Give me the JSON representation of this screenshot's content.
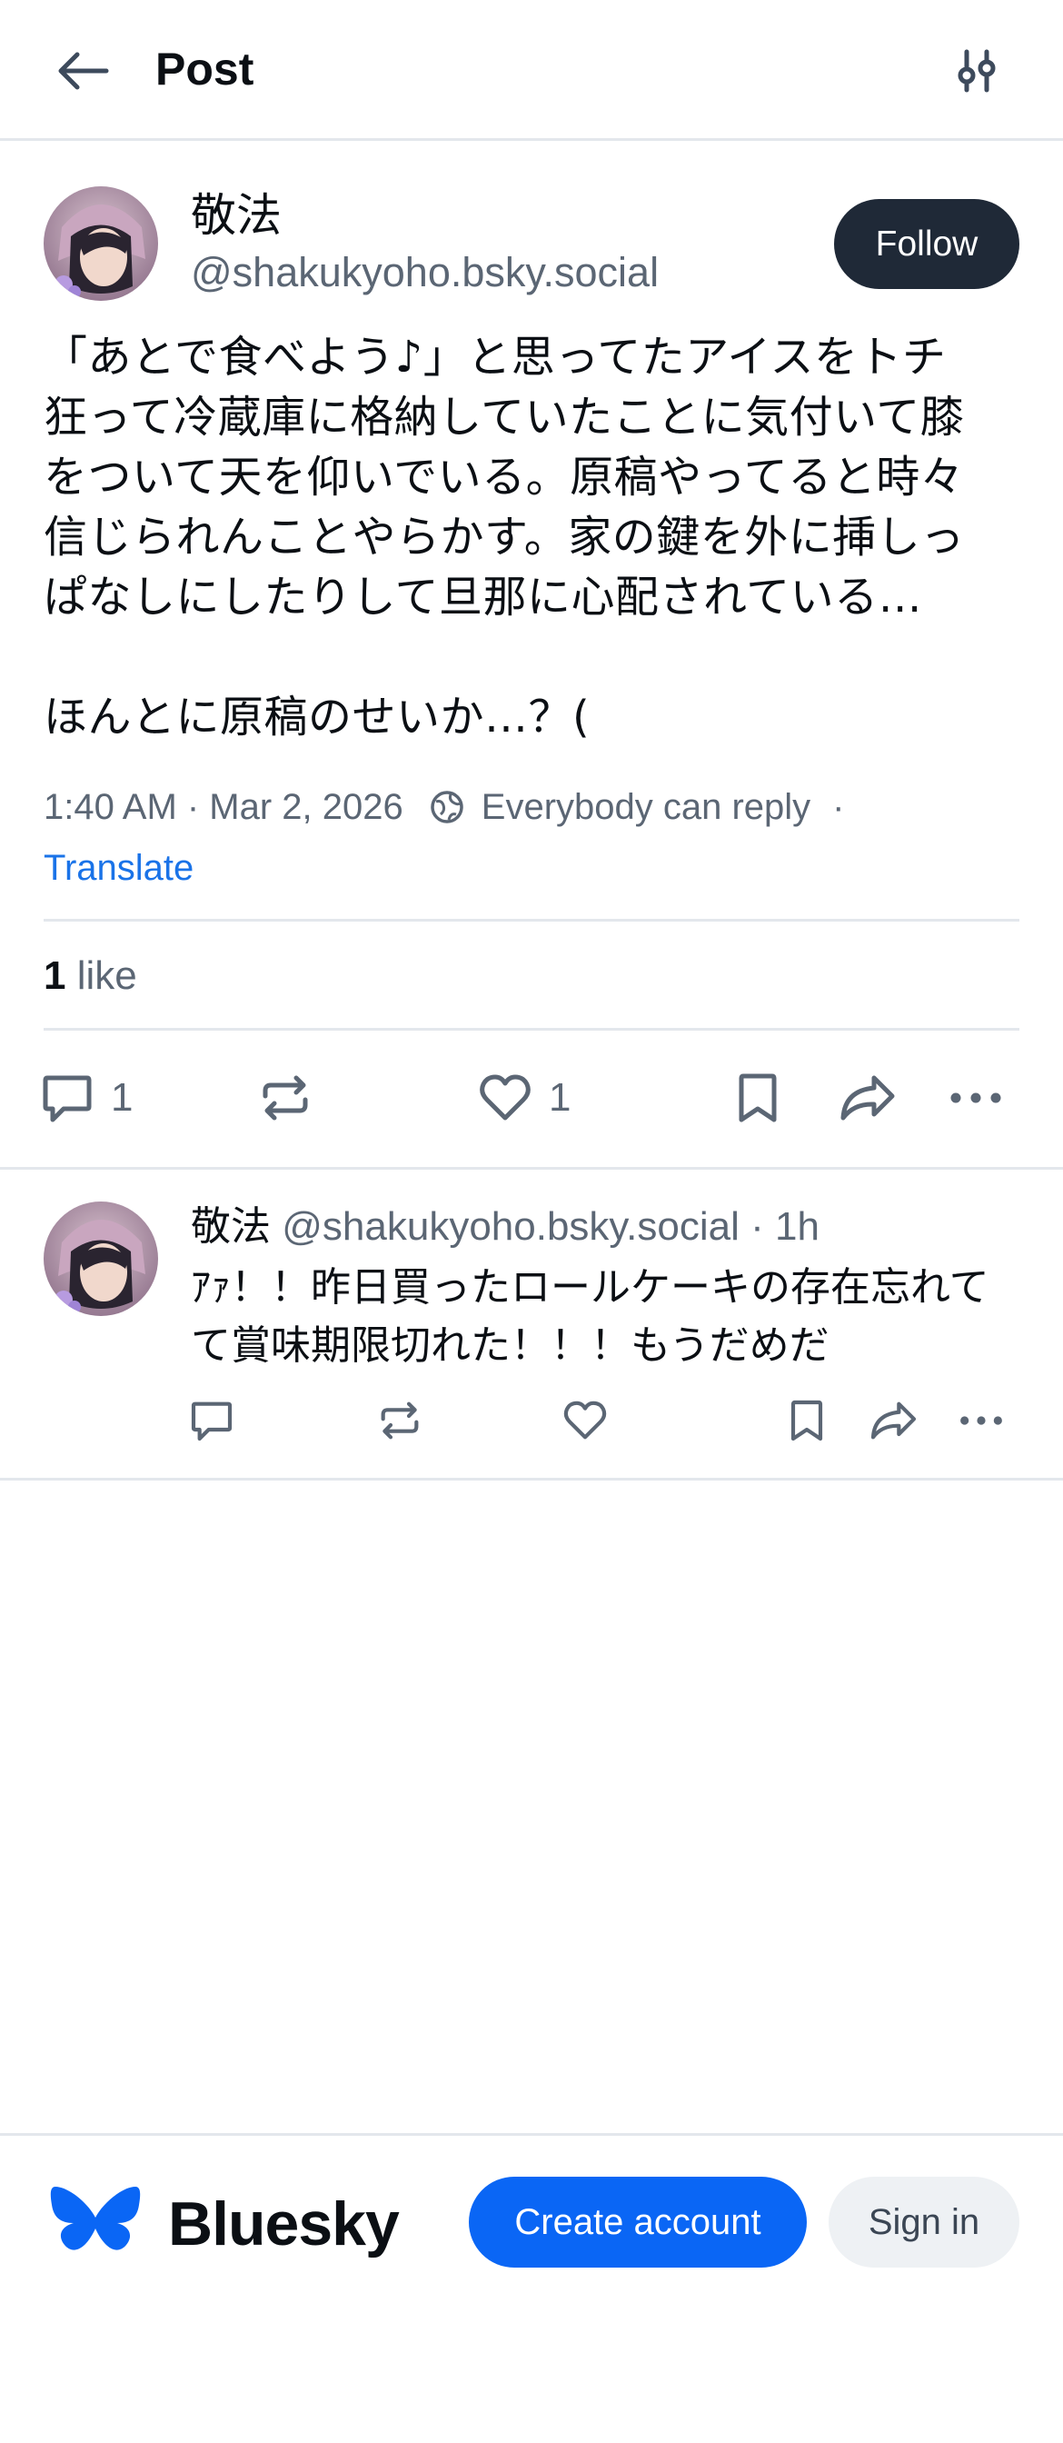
{
  "header": {
    "title": "Post",
    "back_icon": "arrow-left-icon",
    "filter_icon": "sliders-icon"
  },
  "post": {
    "author_name": "敬法",
    "author_handle": "@shakukyoho.bsky.social",
    "follow_label": "Follow",
    "text": "「あとで食べよう♪」と思ってたアイスをトチ\n狂って冷蔵庫に格納していたことに気付いて膝\nをついて天を仰いでいる。原稿やってると時々\n信じられんことやらかす。家の鍵を外に挿しっ\nぱなしにしたりして旦那に心配されている…\n\nほんとに原稿のせいか…？(",
    "timestamp": "1:40 AM · Mar 2, 2026",
    "reply_setting": "Everybody can reply",
    "separator": "·",
    "translate_label": "Translate",
    "likes_count": "1",
    "likes_label": "like",
    "reply_count": "1",
    "like_count": "1"
  },
  "reply": {
    "author_name": "敬法",
    "author_handle": "@shakukyoho.bsky.social",
    "time": "· 1h",
    "text": "ｱｧ！！昨日買ったロールケーキの存在忘れてて賞味期限切れた！！！もうだめだ"
  },
  "bottom_bar": {
    "brand_name": "Bluesky",
    "create_account_label": "Create account",
    "sign_in_label": "Sign in"
  },
  "colors": {
    "accent_blue": "#0a66f5",
    "follow_bg": "#1f2937",
    "muted_text": "#5b6674",
    "divider": "#e3e7ec",
    "link": "#1a73e8"
  }
}
